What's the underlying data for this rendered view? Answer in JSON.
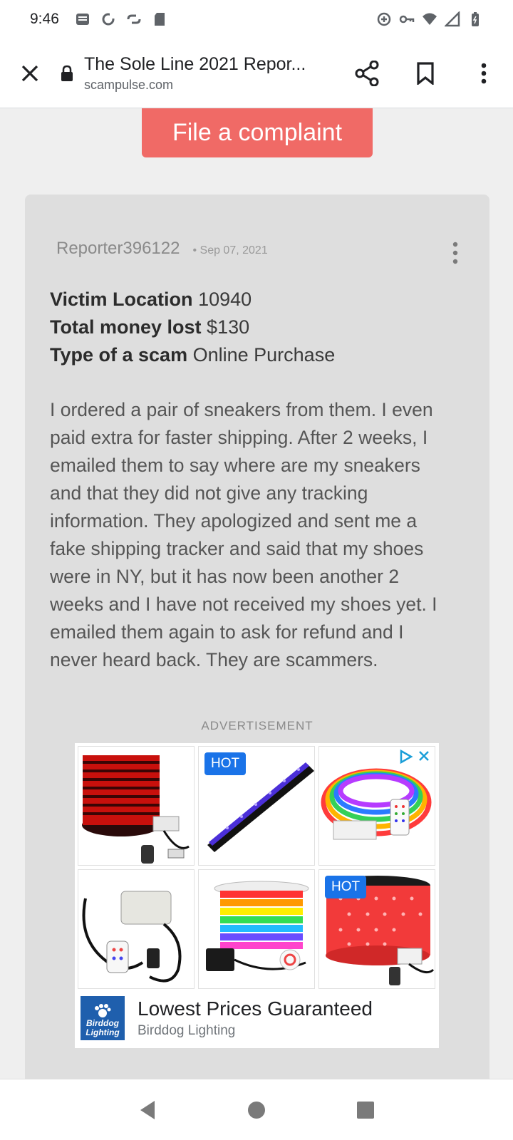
{
  "status_bar": {
    "time": "9:46"
  },
  "toolbar": {
    "page_title": "The Sole Line 2021 Repor...",
    "url": "scampulse.com"
  },
  "complaint_button": "File a complaint",
  "report": {
    "reporter": "Reporter396122",
    "date": "• Sep 07, 2021",
    "fields": [
      {
        "label": "Victim Location",
        "value": "10940"
      },
      {
        "label": "Total money lost",
        "value": "$130"
      },
      {
        "label": "Type of a scam",
        "value": "Online Purchase"
      }
    ],
    "body": "I ordered a pair of sneakers from them. I even paid extra for faster shipping. After 2 weeks, I emailed them to say where are my sneakers and that they did not give any tracking information. They apologized and sent me a fake shipping tracker and said that my shoes were in NY, but it has now been another 2 weeks and I have not received my shoes yet. I emailed them again to ask for refund and I never heard back. They are scammers."
  },
  "advertisement": {
    "label": "ADVERTISEMENT",
    "hot_badge": "HOT",
    "headline": "Lowest Prices Guaranteed",
    "brand": "Birddog Lighting",
    "logo_text_1": "Birddog",
    "logo_text_2": "Lighting"
  },
  "colors": {
    "button": "#f06a66",
    "card": "#dedede",
    "badge": "#1a73e8"
  }
}
